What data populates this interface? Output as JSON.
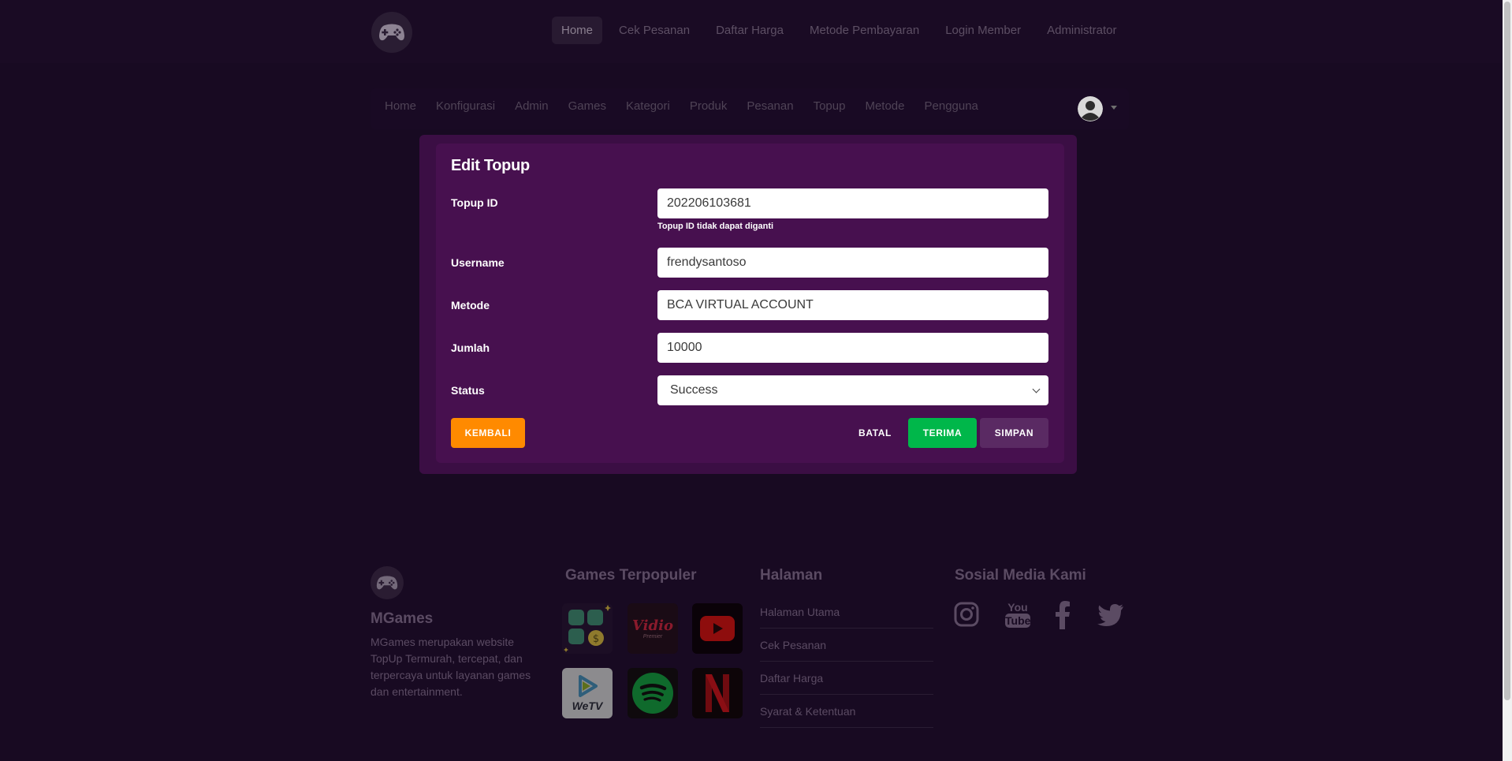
{
  "topnav": {
    "items": [
      "Home",
      "Cek Pesanan",
      "Daftar Harga",
      "Metode Pembayaran",
      "Login Member",
      "Administrator"
    ]
  },
  "adminnav": {
    "items": [
      "Home",
      "Konfigurasi",
      "Admin",
      "Games",
      "Kategori",
      "Produk",
      "Pesanan",
      "Topup",
      "Metode",
      "Pengguna"
    ]
  },
  "modal": {
    "title": "Edit Topup",
    "fields": {
      "topup_id": {
        "label": "Topup ID",
        "value": "202206103681",
        "help": "Topup ID tidak dapat diganti"
      },
      "username": {
        "label": "Username",
        "value": "frendysantoso"
      },
      "metode": {
        "label": "Metode",
        "value": "BCA VIRTUAL ACCOUNT"
      },
      "jumlah": {
        "label": "Jumlah",
        "value": "10000"
      },
      "status": {
        "label": "Status",
        "value": "Success"
      }
    },
    "buttons": {
      "kembali": "KEMBALI",
      "batal": "BATAL",
      "terima": "TERIMA",
      "simpan": "SIMPAN"
    }
  },
  "footer": {
    "brand": "MGames",
    "description": "MGames merupakan website TopUp Termurah, tercepat, dan terpercaya untuk layanan games dan entertainment.",
    "games_heading": "Games Terpopuler",
    "games": [
      "dollar-coins",
      "vidio",
      "youtube",
      "wetv",
      "spotify",
      "netflix"
    ],
    "vidio_text": "Vidio",
    "vidio_sub": "Premier",
    "wetv_text": "WeTV",
    "pages_heading": "Halaman",
    "pages": [
      "Halaman Utama",
      "Cek Pesanan",
      "Daftar Harga",
      "Syarat & Ketentuan"
    ],
    "social_heading": "Sosial Media Kami",
    "socials": [
      "instagram-icon",
      "youtube-icon",
      "facebook-icon",
      "twitter-icon"
    ],
    "youtube_social": {
      "you": "You",
      "tube": "Tube"
    }
  },
  "colors": {
    "background": "#180a22",
    "modal": "#47104f",
    "orange": "#ff8a00",
    "green": "#00b74a",
    "purple_btn": "#5a2a63"
  }
}
